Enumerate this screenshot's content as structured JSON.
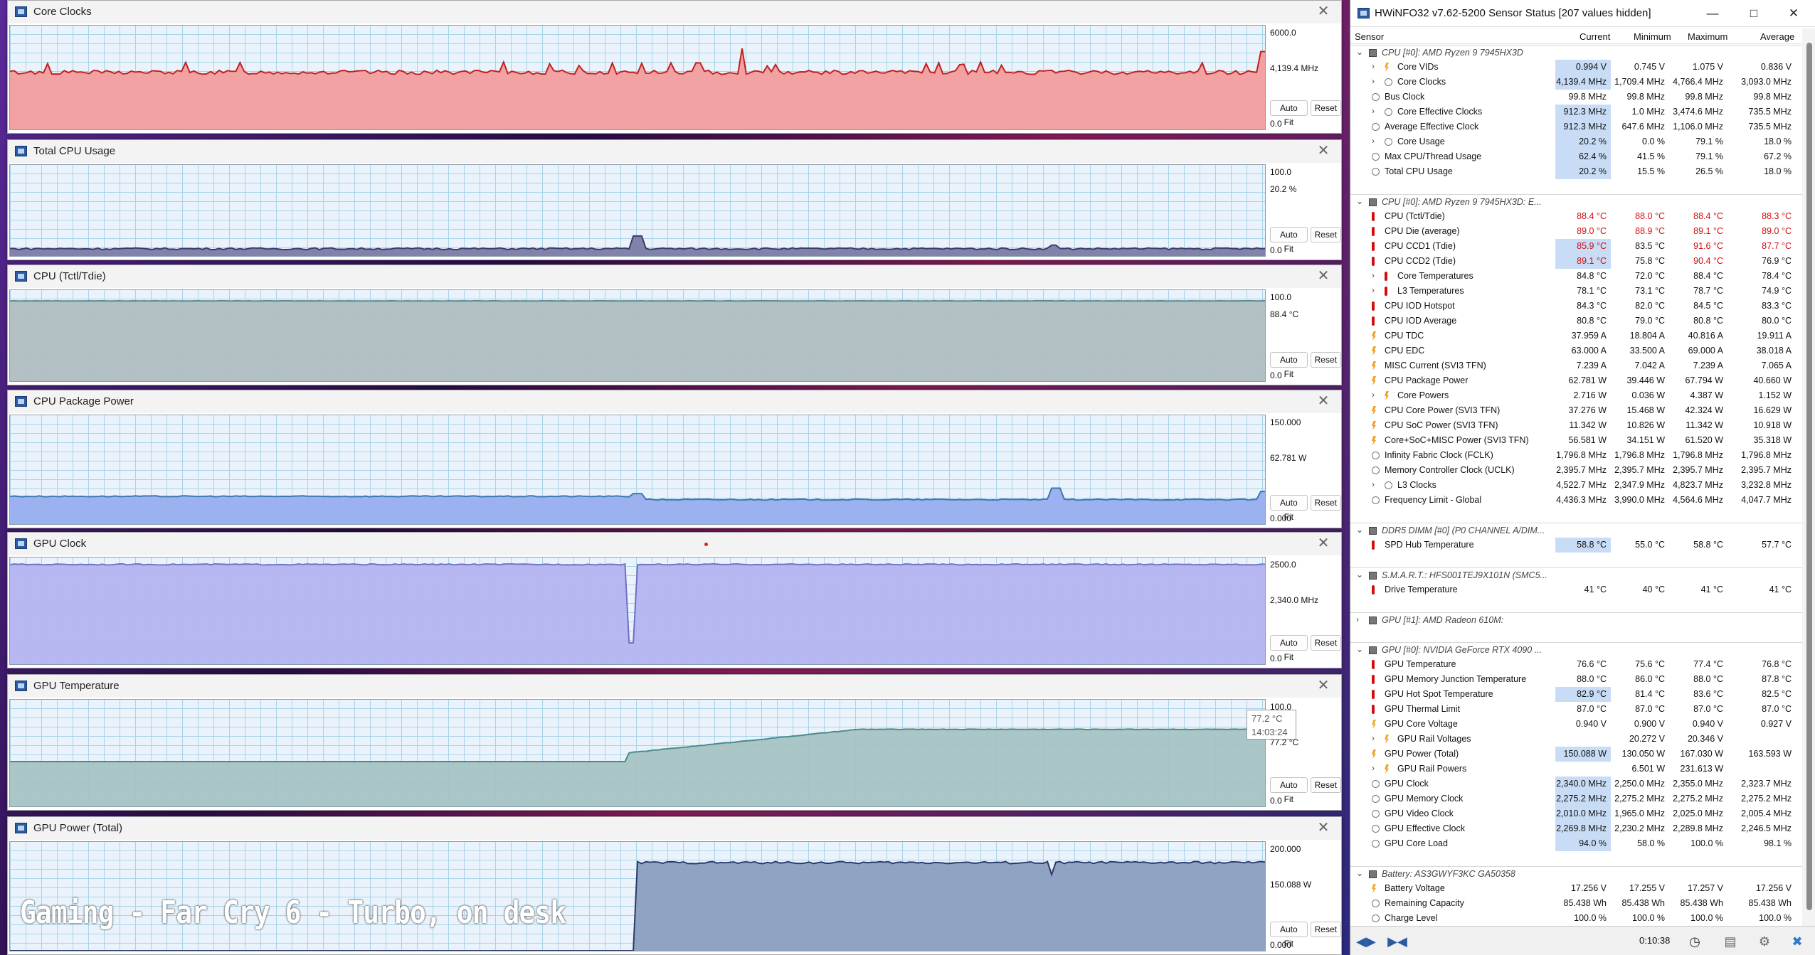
{
  "graph_windows": [
    {
      "title": "Core Clocks",
      "max": "6000.0",
      "current": "4,139.4 MHz",
      "min": "0.0",
      "color": "#f29d9d",
      "line": "#c02020",
      "chip": "#d01010",
      "level": 0.69
    },
    {
      "title": "Total CPU Usage",
      "max": "100.0",
      "current": "20.2 %",
      "min": "0.0",
      "color": "#7c7ca6",
      "line": "#3a3a6a",
      "chip": "#444477",
      "level": 0.06
    },
    {
      "title": "CPU (Tctl/Tdie)",
      "max": "100.0",
      "current": "88.4 °C",
      "min": "0.0",
      "color": "#b0bec1",
      "line": "#5a8a8a",
      "chip": "#708a8a",
      "level": 0.88
    },
    {
      "title": "CPU Package Power",
      "max": "150.000",
      "current": "62.781 W",
      "min": "0.000",
      "color": "#98aeef",
      "line": "#3a78b0",
      "chip": "#2a6ab0",
      "level": 0.38
    },
    {
      "title": "GPU Clock",
      "max": "2500.0",
      "current": "2,340.0 MHz",
      "min": "0.0",
      "color": "#b4b4f0",
      "line": "#7070c0",
      "chip": "#7a7ad0",
      "level": 0.94
    },
    {
      "title": "GPU Temperature",
      "max": "100.0",
      "current": "77.2 °C",
      "min": "0.0",
      "color": "#a6c3c3",
      "line": "#4a8a8a",
      "chip": "#5a9a9a",
      "level": 0.77
    },
    {
      "title": "GPU Power (Total)",
      "max": "200.000",
      "current": "150.088 W",
      "min": "0.000",
      "color": "#8c9ebf",
      "line": "#2a3a6a",
      "chip": "#1a2a6a",
      "level": 0.75
    }
  ],
  "buttons": {
    "autofit": "Auto Fit",
    "reset": "Reset"
  },
  "tooltip": {
    "value": "77.2 °C",
    "time": "14:03:24"
  },
  "caption": "Gaming - Far Cry 6 - Turbo, on desk",
  "hwinfo": {
    "title": "HWiNFO32 v7.62-5200 Sensor Status [207 values hidden]",
    "columns": {
      "sensor": "Sensor",
      "current": "Current",
      "minimum": "Minimum",
      "maximum": "Maximum",
      "average": "Average"
    },
    "timer": "0:10:38",
    "rows": [
      {
        "t": "group",
        "label": "CPU [#0]: AMD Ryzen 9 7945HX3D"
      },
      {
        "t": "row",
        "exp": true,
        "icon": "vol",
        "label": "Core VIDs",
        "v": [
          "0.994 V",
          "0.745 V",
          "1.075 V",
          "0.836 V"
        ],
        "hl": true
      },
      {
        "t": "row",
        "exp": true,
        "icon": "clk",
        "label": "Core Clocks",
        "v": [
          "4,139.4 MHz",
          "1,709.4 MHz",
          "4,766.4 MHz",
          "3,093.0 MHz"
        ],
        "hl": true
      },
      {
        "t": "row",
        "icon": "clk",
        "label": "Bus Clock",
        "v": [
          "99.8 MHz",
          "99.8 MHz",
          "99.8 MHz",
          "99.8 MHz"
        ]
      },
      {
        "t": "row",
        "exp": true,
        "icon": "clk",
        "label": "Core Effective Clocks",
        "v": [
          "912.3 MHz",
          "1.0 MHz",
          "3,474.6 MHz",
          "735.5 MHz"
        ],
        "hl": true
      },
      {
        "t": "row",
        "icon": "clk",
        "label": "Average Effective Clock",
        "v": [
          "912.3 MHz",
          "647.6 MHz",
          "1,106.0 MHz",
          "735.5 MHz"
        ],
        "hl": true
      },
      {
        "t": "row",
        "exp": true,
        "icon": "pct",
        "label": "Core Usage",
        "v": [
          "20.2 %",
          "0.0 %",
          "79.1 %",
          "18.0 %"
        ],
        "hl": true
      },
      {
        "t": "row",
        "icon": "pct",
        "label": "Max CPU/Thread Usage",
        "v": [
          "62.4 %",
          "41.5 %",
          "79.1 %",
          "67.2 %"
        ],
        "hl": true
      },
      {
        "t": "row",
        "icon": "pct",
        "label": "Total CPU Usage",
        "v": [
          "20.2 %",
          "15.5 %",
          "26.5 %",
          "18.0 %"
        ],
        "hl": true
      },
      {
        "t": "blank"
      },
      {
        "t": "group",
        "label": "CPU [#0]: AMD Ryzen 9 7945HX3D: E..."
      },
      {
        "t": "row",
        "icon": "tmp",
        "label": "CPU (Tctl/Tdie)",
        "v": [
          "88.4 °C",
          "88.0 °C",
          "88.4 °C",
          "88.3 °C"
        ],
        "red": [
          0,
          1,
          2,
          3
        ]
      },
      {
        "t": "row",
        "icon": "tmp",
        "label": "CPU Die (average)",
        "v": [
          "89.0 °C",
          "88.9 °C",
          "89.1 °C",
          "89.0 °C"
        ],
        "red": [
          0,
          1,
          2,
          3
        ]
      },
      {
        "t": "row",
        "icon": "tmp",
        "label": "CPU CCD1 (Tdie)",
        "v": [
          "85.9 °C",
          "83.5 °C",
          "91.6 °C",
          "87.7 °C"
        ],
        "red": [
          0,
          2,
          3
        ],
        "hl": true
      },
      {
        "t": "row",
        "icon": "tmp",
        "label": "CPU CCD2 (Tdie)",
        "v": [
          "89.1 °C",
          "75.8 °C",
          "90.4 °C",
          "76.9 °C"
        ],
        "red": [
          0,
          2
        ],
        "hl": true
      },
      {
        "t": "row",
        "exp": true,
        "icon": "tmp",
        "label": "Core Temperatures",
        "v": [
          "84.8 °C",
          "72.0 °C",
          "88.4 °C",
          "78.4 °C"
        ]
      },
      {
        "t": "row",
        "exp": true,
        "icon": "tmp",
        "label": "L3 Temperatures",
        "v": [
          "78.1 °C",
          "73.1 °C",
          "78.7 °C",
          "74.9 °C"
        ]
      },
      {
        "t": "row",
        "icon": "tmp",
        "label": "CPU IOD Hotspot",
        "v": [
          "84.3 °C",
          "82.0 °C",
          "84.5 °C",
          "83.3 °C"
        ]
      },
      {
        "t": "row",
        "icon": "tmp",
        "label": "CPU IOD Average",
        "v": [
          "80.8 °C",
          "79.0 °C",
          "80.8 °C",
          "80.0 °C"
        ]
      },
      {
        "t": "row",
        "icon": "pwr",
        "label": "CPU TDC",
        "v": [
          "37.959 A",
          "18.804 A",
          "40.816 A",
          "19.911 A"
        ]
      },
      {
        "t": "row",
        "icon": "pwr",
        "label": "CPU EDC",
        "v": [
          "63.000 A",
          "33.500 A",
          "69.000 A",
          "38.018 A"
        ]
      },
      {
        "t": "row",
        "icon": "pwr",
        "label": "MISC Current (SVI3 TFN)",
        "v": [
          "7.239 A",
          "7.042 A",
          "7.239 A",
          "7.065 A"
        ]
      },
      {
        "t": "row",
        "icon": "pwr",
        "label": "CPU Package Power",
        "v": [
          "62.781 W",
          "39.446 W",
          "67.794 W",
          "40.660 W"
        ]
      },
      {
        "t": "row",
        "exp": true,
        "icon": "pwr",
        "label": "Core Powers",
        "v": [
          "2.716 W",
          "0.036 W",
          "4.387 W",
          "1.152 W"
        ]
      },
      {
        "t": "row",
        "icon": "pwr",
        "label": "CPU Core Power (SVI3 TFN)",
        "v": [
          "37.276 W",
          "15.468 W",
          "42.324 W",
          "16.629 W"
        ]
      },
      {
        "t": "row",
        "icon": "pwr",
        "label": "CPU SoC Power (SVI3 TFN)",
        "v": [
          "11.342 W",
          "10.826 W",
          "11.342 W",
          "10.918 W"
        ]
      },
      {
        "t": "row",
        "icon": "pwr",
        "label": "Core+SoC+MISC Power (SVI3 TFN)",
        "v": [
          "56.581 W",
          "34.151 W",
          "61.520 W",
          "35.318 W"
        ]
      },
      {
        "t": "row",
        "icon": "clk",
        "label": "Infinity Fabric Clock (FCLK)",
        "v": [
          "1,796.8 MHz",
          "1,796.8 MHz",
          "1,796.8 MHz",
          "1,796.8 MHz"
        ]
      },
      {
        "t": "row",
        "icon": "clk",
        "label": "Memory Controller Clock (UCLK)",
        "v": [
          "2,395.7 MHz",
          "2,395.7 MHz",
          "2,395.7 MHz",
          "2,395.7 MHz"
        ]
      },
      {
        "t": "row",
        "exp": true,
        "icon": "clk",
        "label": "L3 Clocks",
        "v": [
          "4,522.7 MHz",
          "2,347.9 MHz",
          "4,823.7 MHz",
          "3,232.8 MHz"
        ]
      },
      {
        "t": "row",
        "icon": "clk",
        "label": "Frequency Limit - Global",
        "v": [
          "4,436.3 MHz",
          "3,990.0 MHz",
          "4,564.6 MHz",
          "4,047.7 MHz"
        ]
      },
      {
        "t": "blank"
      },
      {
        "t": "group",
        "label": "DDR5 DIMM [#0] (P0 CHANNEL A/DIM..."
      },
      {
        "t": "row",
        "icon": "tmp",
        "label": "SPD Hub Temperature",
        "v": [
          "58.8 °C",
          "55.0 °C",
          "58.8 °C",
          "57.7 °C"
        ],
        "hl": true
      },
      {
        "t": "blank"
      },
      {
        "t": "group",
        "label": "S.M.A.R.T.: HFS001TEJ9X101N (SMC5..."
      },
      {
        "t": "row",
        "icon": "tmp",
        "label": "Drive Temperature",
        "v": [
          "41 °C",
          "40 °C",
          "41 °C",
          "41 °C"
        ]
      },
      {
        "t": "blank"
      },
      {
        "t": "groupc",
        "label": "GPU [#1]: AMD Radeon 610M:"
      },
      {
        "t": "blank"
      },
      {
        "t": "group",
        "label": "GPU [#0]: NVIDIA GeForce RTX 4090 ..."
      },
      {
        "t": "row",
        "icon": "tmp",
        "label": "GPU Temperature",
        "v": [
          "76.6 °C",
          "75.6 °C",
          "77.4 °C",
          "76.8 °C"
        ]
      },
      {
        "t": "row",
        "icon": "tmp",
        "label": "GPU Memory Junction Temperature",
        "v": [
          "88.0 °C",
          "86.0 °C",
          "88.0 °C",
          "87.8 °C"
        ]
      },
      {
        "t": "row",
        "icon": "tmp",
        "label": "GPU Hot Spot Temperature",
        "v": [
          "82.9 °C",
          "81.4 °C",
          "83.6 °C",
          "82.5 °C"
        ],
        "hl": true
      },
      {
        "t": "row",
        "icon": "tmp",
        "label": "GPU Thermal Limit",
        "v": [
          "87.0 °C",
          "87.0 °C",
          "87.0 °C",
          "87.0 °C"
        ]
      },
      {
        "t": "row",
        "icon": "vol",
        "label": "GPU Core Voltage",
        "v": [
          "0.940 V",
          "0.900 V",
          "0.940 V",
          "0.927 V"
        ]
      },
      {
        "t": "row",
        "exp": true,
        "icon": "vol",
        "label": "GPU Rail Voltages",
        "v": [
          "",
          "20.272 V",
          "20.346 V",
          ""
        ]
      },
      {
        "t": "row",
        "icon": "pwr",
        "label": "GPU Power (Total)",
        "v": [
          "150.088 W",
          "130.050 W",
          "167.030 W",
          "163.593 W"
        ],
        "hl": true
      },
      {
        "t": "row",
        "exp": true,
        "icon": "pwr",
        "label": "GPU Rail Powers",
        "v": [
          "",
          "6.501 W",
          "231.613 W",
          ""
        ]
      },
      {
        "t": "row",
        "icon": "clk",
        "label": "GPU Clock",
        "v": [
          "2,340.0 MHz",
          "2,250.0 MHz",
          "2,355.0 MHz",
          "2,323.7 MHz"
        ],
        "hl": true
      },
      {
        "t": "row",
        "icon": "clk",
        "label": "GPU Memory Clock",
        "v": [
          "2,275.2 MHz",
          "2,275.2 MHz",
          "2,275.2 MHz",
          "2,275.2 MHz"
        ],
        "hl": true
      },
      {
        "t": "row",
        "icon": "clk",
        "label": "GPU Video Clock",
        "v": [
          "2,010.0 MHz",
          "1,965.0 MHz",
          "2,025.0 MHz",
          "2,005.4 MHz"
        ],
        "hl": true
      },
      {
        "t": "row",
        "icon": "clk",
        "label": "GPU Effective Clock",
        "v": [
          "2,269.8 MHz",
          "2,230.2 MHz",
          "2,289.8 MHz",
          "2,246.5 MHz"
        ],
        "hl": true
      },
      {
        "t": "row",
        "icon": "pct",
        "label": "GPU Core Load",
        "v": [
          "94.0 %",
          "58.0 %",
          "100.0 %",
          "98.1 %"
        ],
        "hl": true
      },
      {
        "t": "blank"
      },
      {
        "t": "group",
        "label": "Battery: AS3GWYF3KC GA50358"
      },
      {
        "t": "row",
        "icon": "vol",
        "label": "Battery Voltage",
        "v": [
          "17.256 V",
          "17.255 V",
          "17.257 V",
          "17.256 V"
        ]
      },
      {
        "t": "row",
        "icon": "pct",
        "label": "Remaining Capacity",
        "v": [
          "85.438 Wh",
          "85.438 Wh",
          "85.438 Wh",
          "85.438 Wh"
        ]
      },
      {
        "t": "row",
        "icon": "pct",
        "label": "Charge Level",
        "v": [
          "100.0 %",
          "100.0 %",
          "100.0 %",
          "100.0 %"
        ]
      }
    ]
  }
}
